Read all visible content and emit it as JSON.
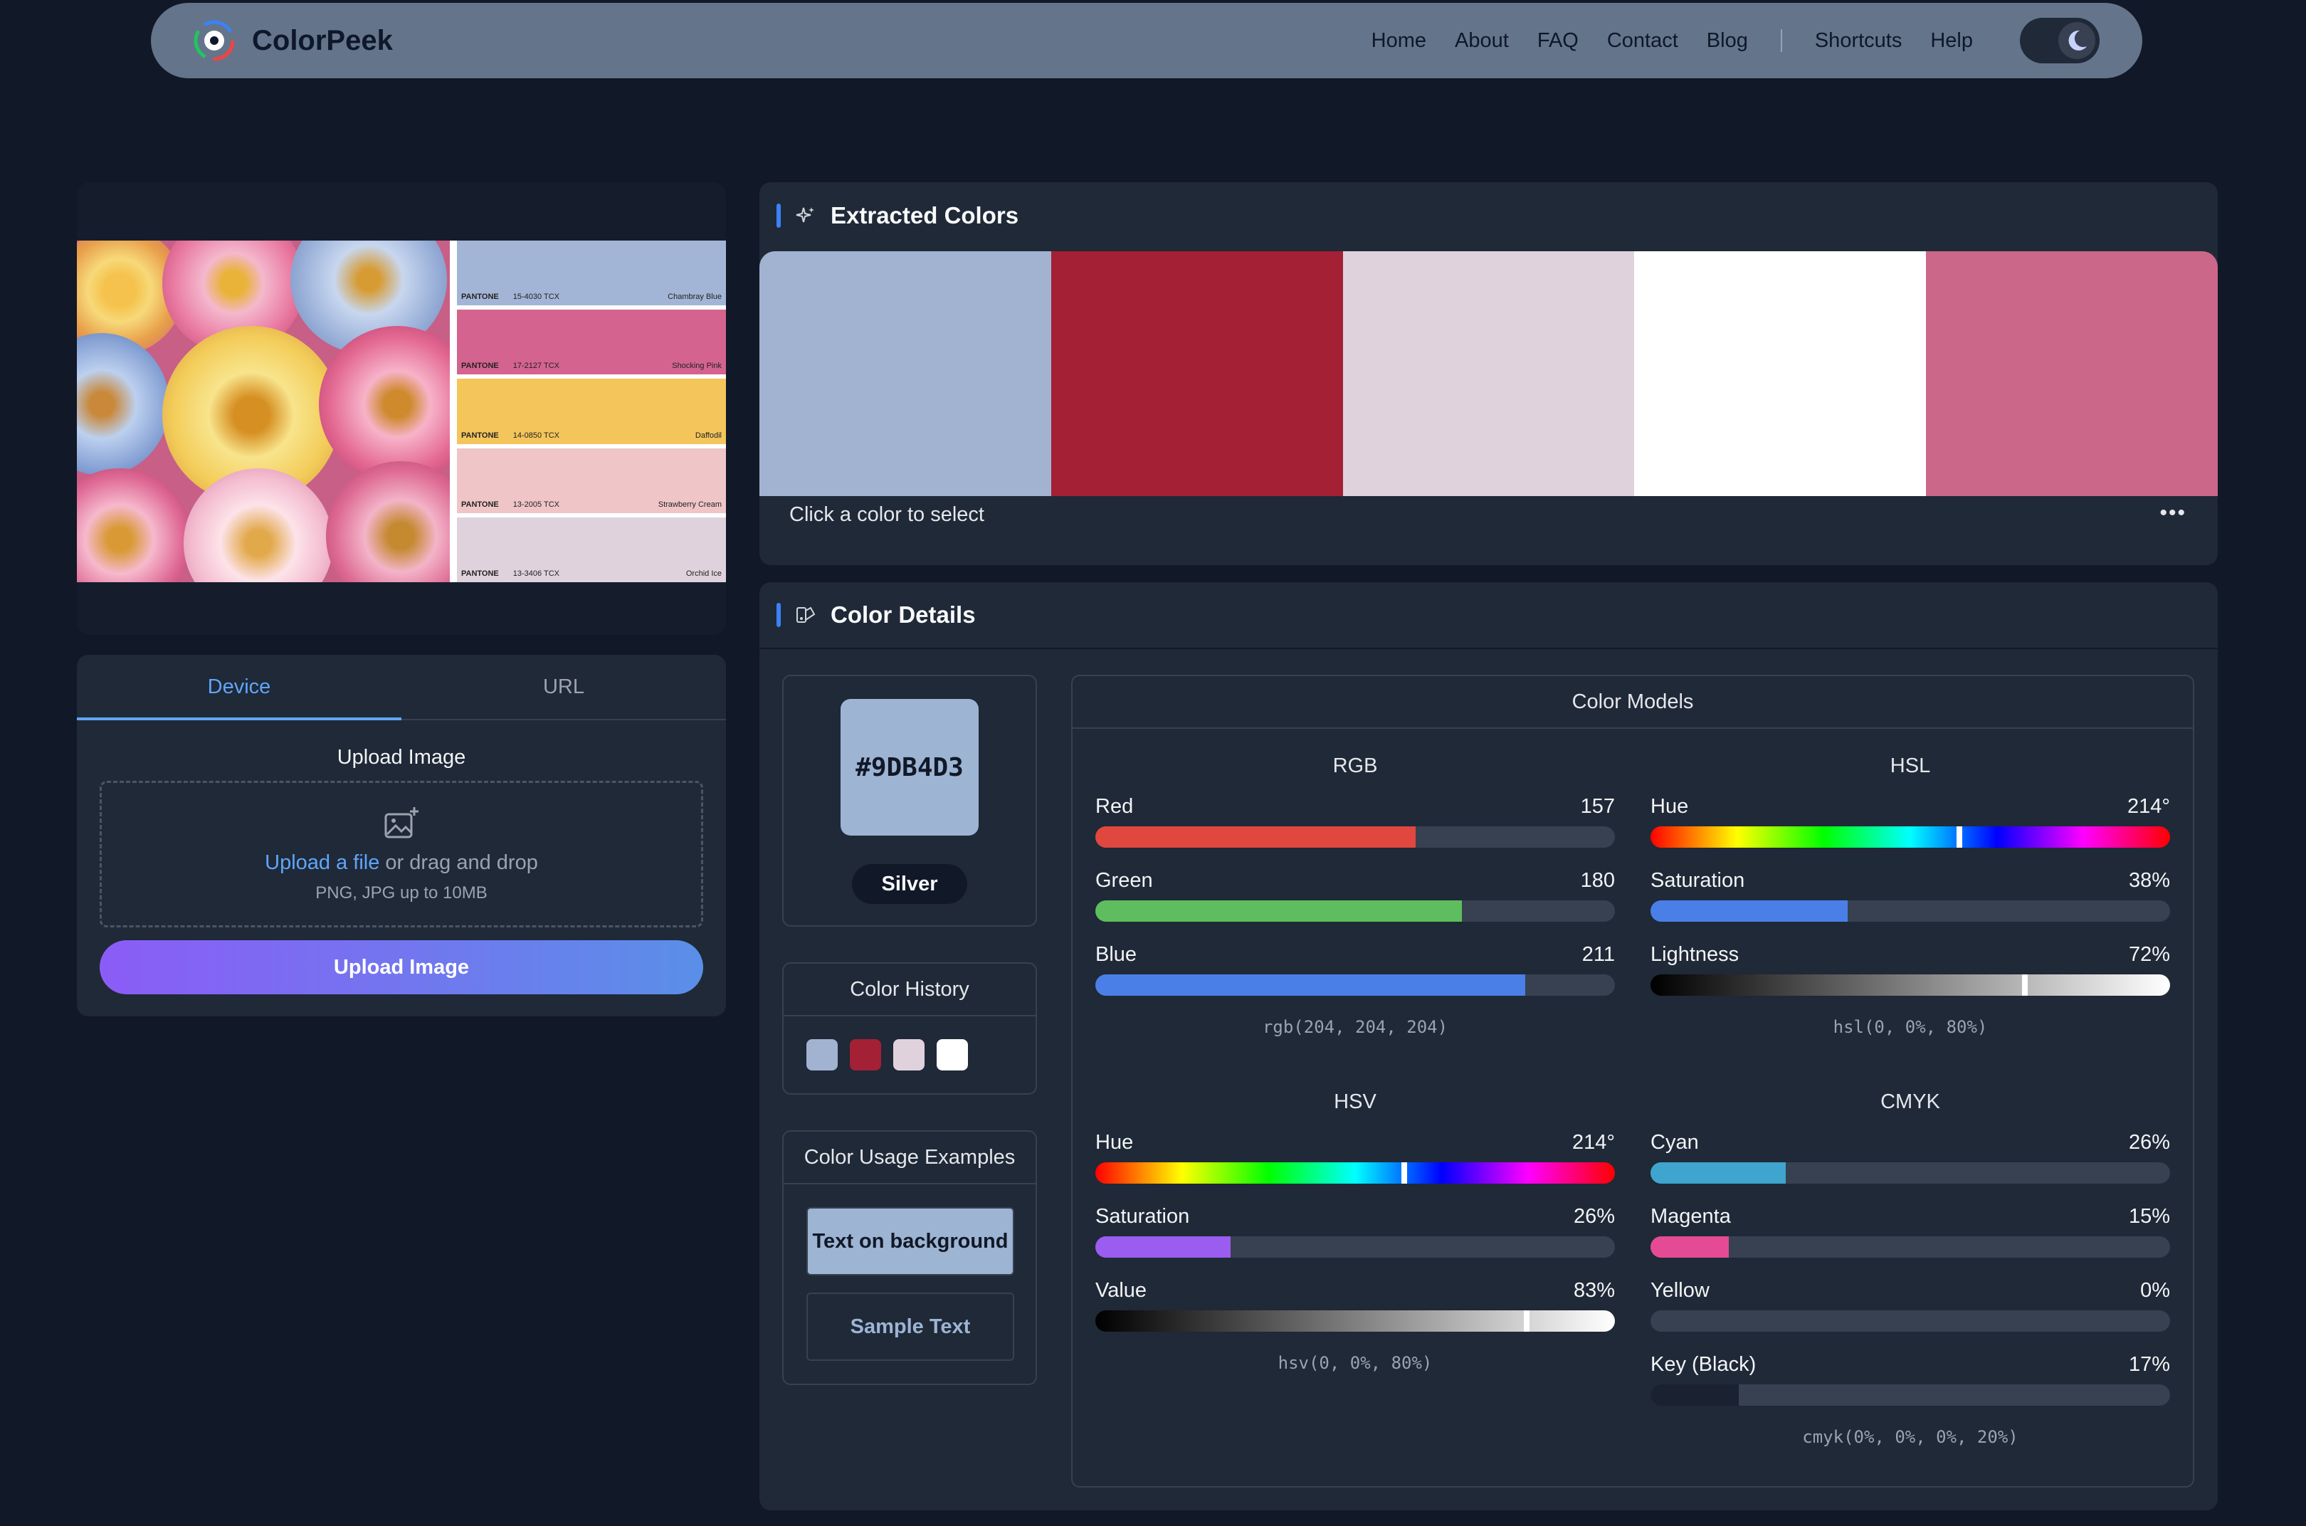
{
  "nav": {
    "brand": "ColorPeek",
    "links": [
      "Home",
      "About",
      "FAQ",
      "Contact",
      "Blog"
    ],
    "links2": [
      "Shortcuts",
      "Help"
    ]
  },
  "preview": {
    "pantone": [
      {
        "code": "15-4030 TCX",
        "name": "Chambray Blue",
        "color": "#a3b5d6"
      },
      {
        "code": "17-2127 TCX",
        "name": "Shocking Pink",
        "color": "#d4638f"
      },
      {
        "code": "14-0850 TCX",
        "name": "Daffodil",
        "color": "#f4c55b"
      },
      {
        "code": "13-2005 TCX",
        "name": "Strawberry Cream",
        "color": "#efc5c8"
      },
      {
        "code": "13-3406 TCX",
        "name": "Orchid Ice",
        "color": "#e0d2dc"
      }
    ],
    "pantone_brand": "PANTONE"
  },
  "upload": {
    "tab_device": "Device",
    "tab_url": "URL",
    "label": "Upload Image",
    "link": "Upload a file",
    "rest": " or drag and drop",
    "hint": "PNG, JPG up to 10MB",
    "button": "Upload Image"
  },
  "extracted": {
    "title": "Extracted Colors",
    "swatches": [
      "#a2b3d1",
      "#a32035",
      "#e0d2dc",
      "#ffffff",
      "#cb6789"
    ],
    "hint": "Click a color to select",
    "more": "•••"
  },
  "details": {
    "title": "Color Details",
    "hex": "#9DB4D3",
    "hex_color": "#9db4d3",
    "name": "Silver",
    "history_title": "Color History",
    "history": [
      "#a2b3d1",
      "#a32035",
      "#e0d2dc",
      "#ffffff"
    ],
    "usage_title": "Color Usage Examples",
    "usage_bg_text": "Text on background",
    "usage_sample": "Sample Text",
    "models_title": "Color Models",
    "rgb": {
      "title": "RGB",
      "rows": [
        {
          "label": "Red",
          "value": "157",
          "pct": 0.616
        },
        {
          "label": "Green",
          "value": "180",
          "pct": 0.706
        },
        {
          "label": "Blue",
          "value": "211",
          "pct": 0.827
        }
      ],
      "css": "rgb(204, 204, 204)"
    },
    "hsl": {
      "title": "HSL",
      "rows": [
        {
          "label": "Hue",
          "value": "214°",
          "pct": 0.594
        },
        {
          "label": "Saturation",
          "value": "38%",
          "pct": 0.38
        },
        {
          "label": "Lightness",
          "value": "72%",
          "pct": 0.72
        }
      ],
      "css": "hsl(0, 0%, 80%)"
    },
    "hsv": {
      "title": "HSV",
      "rows": [
        {
          "label": "Hue",
          "value": "214°",
          "pct": 0.594
        },
        {
          "label": "Saturation",
          "value": "26%",
          "pct": 0.26
        },
        {
          "label": "Value",
          "value": "83%",
          "pct": 0.83
        }
      ],
      "css": "hsv(0, 0%, 80%)"
    },
    "cmyk": {
      "title": "CMYK",
      "rows": [
        {
          "label": "Cyan",
          "value": "26%",
          "pct": 0.26
        },
        {
          "label": "Magenta",
          "value": "15%",
          "pct": 0.15
        },
        {
          "label": "Yellow",
          "value": "0%",
          "pct": 0.0
        },
        {
          "label": "Key (Black)",
          "value": "17%",
          "pct": 0.17
        }
      ],
      "css": "cmyk(0%, 0%, 0%, 20%)"
    }
  }
}
